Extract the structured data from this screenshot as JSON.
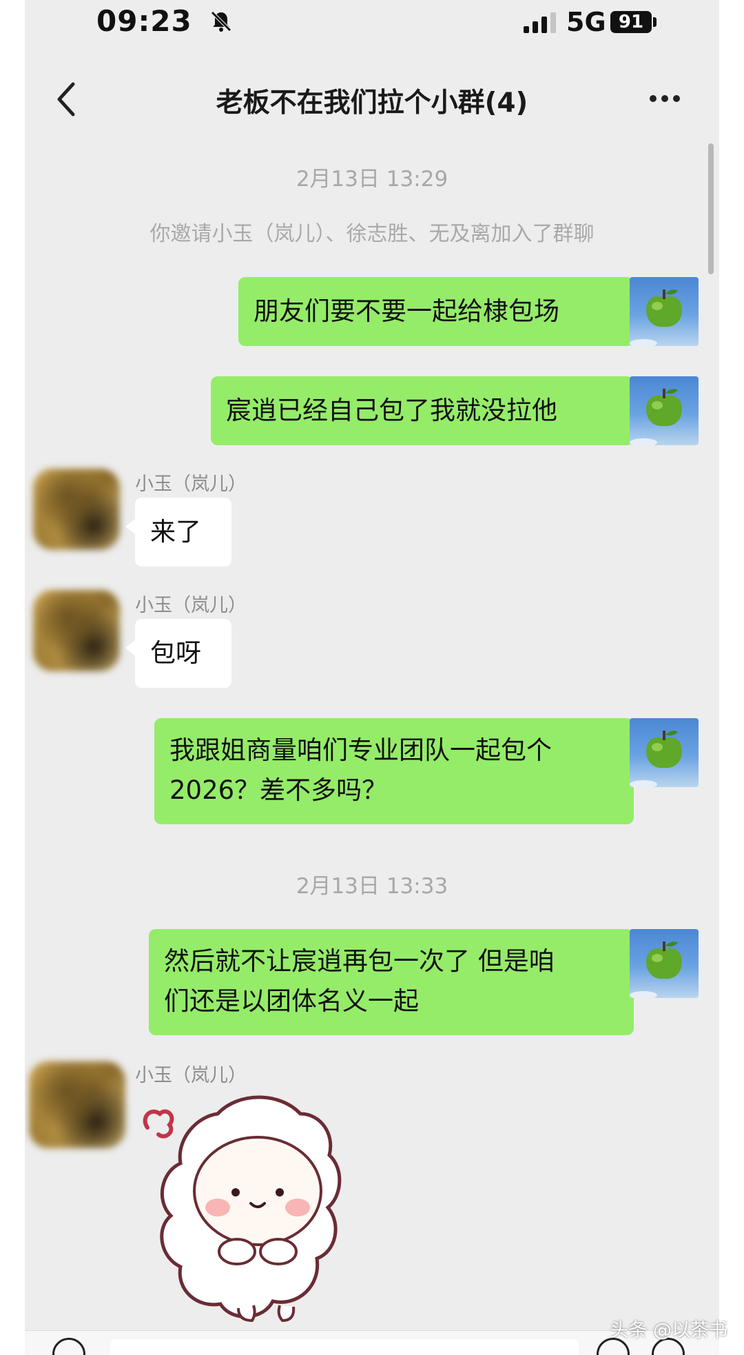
{
  "status_bar": {
    "time": "09:23",
    "network": "5G",
    "battery": "91"
  },
  "header": {
    "title": "老板不在我们拉个小群(4)"
  },
  "messages": {
    "ts1": "2月13日 13:29",
    "system": "你邀请小玉（岚儿）、徐志胜、无及离加入了群聊",
    "m1": "朋友们要不要一起给棣包场",
    "m2": "宸逍已经自己包了我就没拉他",
    "sender": "小玉（岚儿）",
    "m3": "来了",
    "m4": "包呀",
    "m5_line1": "我跟姐商量咱们专业团队一起包个",
    "m5_line2": "2026？差不多吗？",
    "ts2": "2月13日 13:33",
    "m6_line1": "然后就不让宸逍再包一次了 但是咱",
    "m6_line2": "们还是以团体名义一起"
  },
  "watermark": "头条 @以茶书",
  "colors": {
    "outgoing_bubble": "#95ec69",
    "incoming_bubble": "#ffffff",
    "background": "#ededed"
  }
}
